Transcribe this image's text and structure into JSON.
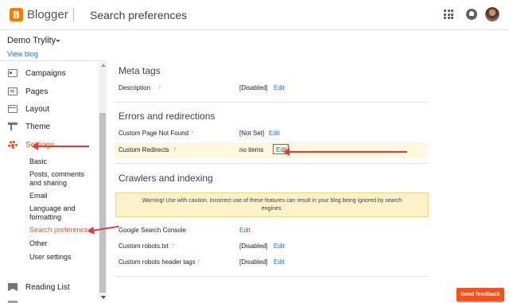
{
  "header": {
    "logo_letter": "B",
    "brand": "Blogger",
    "title": "Search preferences"
  },
  "sidebar": {
    "blog_name": "Demo Trylity",
    "view_blog": "View blog",
    "items": [
      {
        "label": "Campaigns",
        "icon": "campaigns-icon"
      },
      {
        "label": "Pages",
        "icon": "pages-icon"
      },
      {
        "label": "Layout",
        "icon": "layout-icon"
      },
      {
        "label": "Theme",
        "icon": "theme-icon"
      },
      {
        "label": "Settings",
        "icon": "gear-icon"
      }
    ],
    "sub_items": [
      {
        "label": "Basic"
      },
      {
        "label": "Posts, comments and sharing"
      },
      {
        "label": "Email"
      },
      {
        "label": "Language and formatting"
      },
      {
        "label": "Search preferences"
      },
      {
        "label": "Other"
      },
      {
        "label": "User settings"
      }
    ],
    "reading_list": "Reading List"
  },
  "main": {
    "meta": {
      "title": "Meta tags",
      "description_label": "Description",
      "description_value": "[Disabled]",
      "edit": "Edit"
    },
    "errors": {
      "title": "Errors and redirections",
      "not_found_label": "Custom Page Not Found",
      "not_found_value": "[Not Set]",
      "redirects_label": "Custom Redirects",
      "redirects_value": "no items",
      "edit": "Edit"
    },
    "crawlers": {
      "title": "Crawlers and indexing",
      "warning": "Warning! Use with caution. Incorrect use of these features can result in your blog being ignored by search engines.",
      "console_label": "Google Search Console",
      "robots_label": "Custom robots.txt",
      "robots_value": "[Disabled]",
      "robots_header_label": "Custom robots header tags",
      "robots_header_value": "[Disabled]",
      "edit": "Edit"
    },
    "help_glyph": "?"
  },
  "feedback_button": "Send feedback",
  "colors": {
    "accent": "#f4511e",
    "link": "#1a73b8",
    "annotation": "#e53935",
    "warning_bg": "#fcf2c9"
  }
}
